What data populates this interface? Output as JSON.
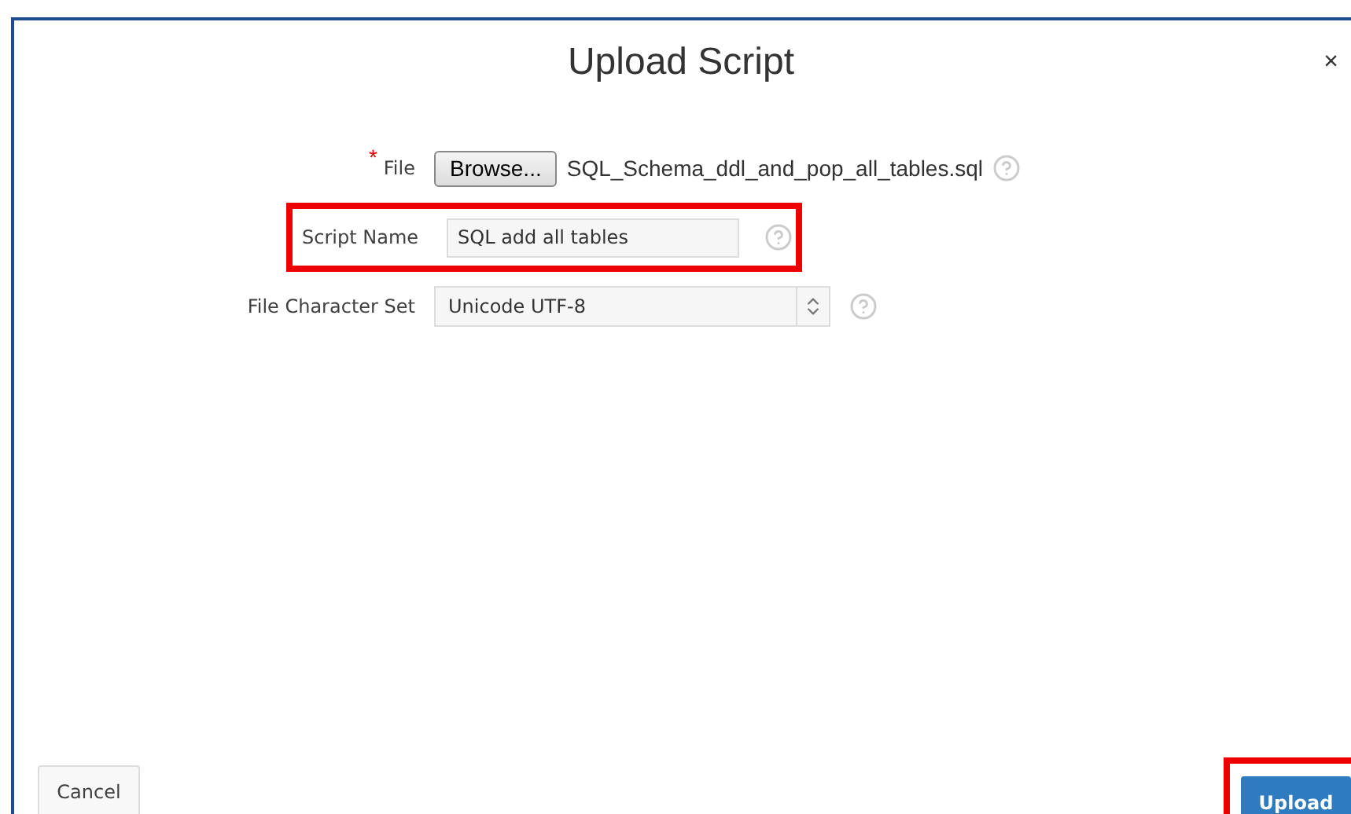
{
  "dialog": {
    "title": "Upload Script",
    "close_label": "×"
  },
  "form": {
    "file": {
      "label": "File",
      "required_mark": "*",
      "browse_label": "Browse...",
      "file_name": "SQL_Schema_ddl_and_pop_all_tables.sql"
    },
    "script_name": {
      "label": "Script Name",
      "value": "SQL add all tables",
      "highlighted": true
    },
    "charset": {
      "label": "File Character Set",
      "value": "Unicode UTF-8"
    }
  },
  "footer": {
    "cancel_label": "Cancel",
    "upload_label": "Upload",
    "upload_highlighted": true
  }
}
